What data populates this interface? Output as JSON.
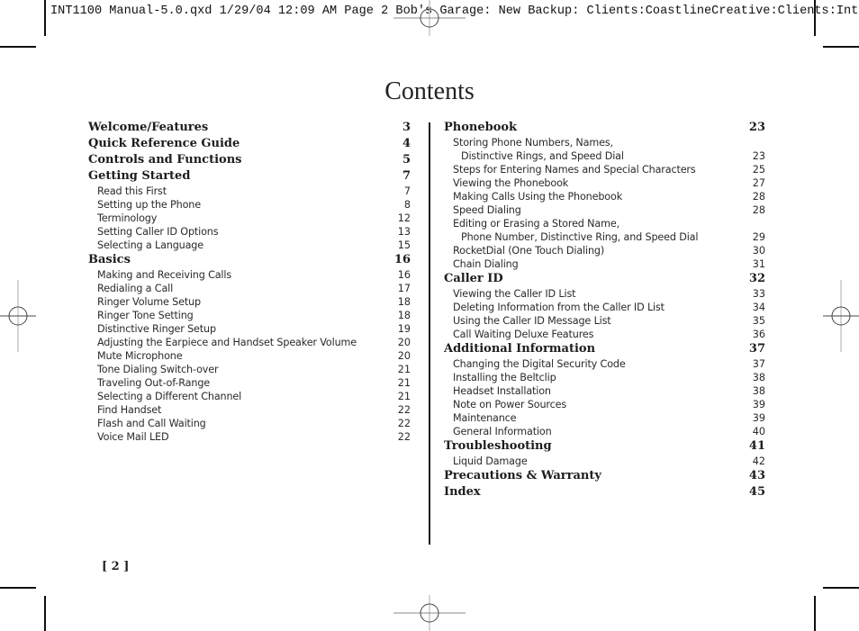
{
  "slug_line": "INT1100 Manual-5.0.qxd  1/29/04  12:09 AM  Page 2 Bob's Garage: New Backup: Clients:CoastlineCreative:Clients:Int",
  "title": "Contents",
  "page_number": "[ 2 ]",
  "left_column": [
    {
      "type": "major",
      "label": "Welcome/Features",
      "page": "3"
    },
    {
      "type": "major",
      "label": "Quick Reference Guide",
      "page": "4"
    },
    {
      "type": "major",
      "label": "Controls and Functions",
      "page": "5"
    },
    {
      "type": "major",
      "label": "Getting Started",
      "page": "7"
    },
    {
      "type": "minor",
      "label": "Read this First",
      "page": "7"
    },
    {
      "type": "minor",
      "label": "Setting up the Phone",
      "page": "8"
    },
    {
      "type": "minor",
      "label": "Terminology",
      "page": "12"
    },
    {
      "type": "minor",
      "label": "Setting Caller ID Options",
      "page": "13"
    },
    {
      "type": "minor",
      "label": "Selecting a Language",
      "page": "15"
    },
    {
      "type": "major",
      "label": "Basics",
      "page": "16"
    },
    {
      "type": "minor",
      "label": "Making and Receiving Calls",
      "page": "16"
    },
    {
      "type": "minor",
      "label": "Redialing a Call",
      "page": "17"
    },
    {
      "type": "minor",
      "label": "Ringer Volume Setup",
      "page": "18"
    },
    {
      "type": "minor",
      "label": "Ringer Tone Setting",
      "page": "18"
    },
    {
      "type": "minor",
      "label": "Distinctive Ringer Setup",
      "page": "19"
    },
    {
      "type": "minor",
      "label": "Adjusting the Earpiece and Handset Speaker Volume",
      "page": "20"
    },
    {
      "type": "minor",
      "label": "Mute Microphone",
      "page": "20"
    },
    {
      "type": "minor",
      "label": "Tone Dialing Switch-over",
      "page": "21"
    },
    {
      "type": "minor",
      "label": "Traveling Out-of-Range",
      "page": "21"
    },
    {
      "type": "minor",
      "label": "Selecting a Different Channel",
      "page": "21"
    },
    {
      "type": "minor",
      "label": "Find Handset",
      "page": "22"
    },
    {
      "type": "minor",
      "label": "Flash and Call Waiting",
      "page": "22"
    },
    {
      "type": "minor",
      "label": "Voice Mail LED",
      "page": "22"
    }
  ],
  "right_column": [
    {
      "type": "major",
      "label": "Phonebook",
      "page": "23"
    },
    {
      "type": "minor",
      "label": "Storing Phone Numbers, Names,",
      "page": ""
    },
    {
      "type": "minor cont",
      "label": "Distinctive Rings, and Speed Dial",
      "page": "23"
    },
    {
      "type": "minor",
      "label": "Steps for Entering Names and Special Characters",
      "page": "25"
    },
    {
      "type": "minor",
      "label": "Viewing the Phonebook",
      "page": "27"
    },
    {
      "type": "minor",
      "label": "Making Calls Using the Phonebook",
      "page": "28"
    },
    {
      "type": "minor",
      "label": "Speed Dialing",
      "page": "28"
    },
    {
      "type": "minor",
      "label": "Editing or Erasing a Stored Name,",
      "page": ""
    },
    {
      "type": "minor cont",
      "label": "Phone Number, Distinctive Ring, and Speed Dial",
      "page": "29"
    },
    {
      "type": "minor",
      "label": "RocketDial (One Touch Dialing)",
      "page": "30"
    },
    {
      "type": "minor",
      "label": "Chain Dialing",
      "page": "31"
    },
    {
      "type": "major",
      "label": "Caller ID",
      "page": "32"
    },
    {
      "type": "minor",
      "label": "Viewing the Caller ID List",
      "page": "33"
    },
    {
      "type": "minor",
      "label": "Deleting Information from the Caller ID List",
      "page": "34"
    },
    {
      "type": "minor",
      "label": "Using the Caller ID Message List",
      "page": "35"
    },
    {
      "type": "minor",
      "label": "Call Waiting Deluxe Features",
      "page": "36"
    },
    {
      "type": "major",
      "label": "Additional Information",
      "page": "37"
    },
    {
      "type": "minor",
      "label": "Changing the Digital Security Code",
      "page": "37"
    },
    {
      "type": "minor",
      "label": "Installing the Beltclip",
      "page": "38"
    },
    {
      "type": "minor",
      "label": "Headset Installation",
      "page": "38"
    },
    {
      "type": "minor",
      "label": "Note on Power Sources",
      "page": "39"
    },
    {
      "type": "minor",
      "label": "Maintenance",
      "page": "39"
    },
    {
      "type": "minor",
      "label": "General Information",
      "page": "40"
    },
    {
      "type": "major",
      "label": "Troubleshooting",
      "page": "41"
    },
    {
      "type": "minor",
      "label": "Liquid Damage",
      "page": "42"
    },
    {
      "type": "major",
      "label": "Precautions & Warranty",
      "page": "43"
    },
    {
      "type": "major",
      "label": "Index",
      "page": "45"
    }
  ]
}
